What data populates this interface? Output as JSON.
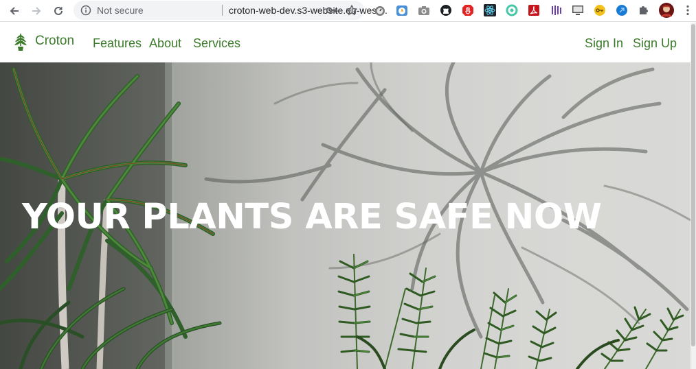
{
  "browser": {
    "security_text": "Not secure",
    "url": "croton-web-dev.s3-website.eu-west...",
    "extensions": [
      "timer-icon",
      "clock-icon",
      "camera-icon",
      "octocat-icon",
      "shield-icon",
      "react-icon",
      "circle-icon",
      "pdf-icon",
      "bars-icon",
      "monitor-icon",
      "key-icon",
      "globe-icon",
      "puzzle-icon",
      "avatar",
      "menu-icon"
    ]
  },
  "site": {
    "brand": "Croton",
    "nav_left": [
      "Features",
      "About",
      "Services"
    ],
    "nav_right": [
      "Sign In",
      "Sign Up"
    ],
    "accent_color": "#3c7a2c"
  },
  "hero": {
    "title": "YOUR PLANTS ARE SAFE NOW"
  }
}
